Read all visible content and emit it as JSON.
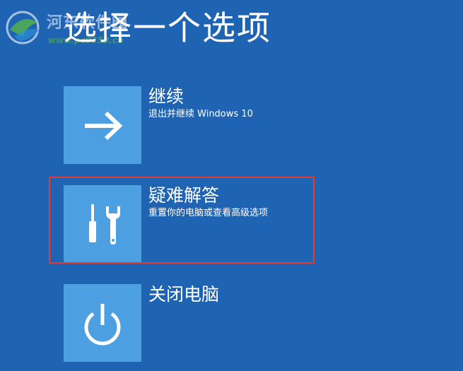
{
  "colors": {
    "background": "#1f63b3",
    "tile": "#4c9fe0",
    "highlight": "#e53935",
    "watermark_green": "#5fbf3a"
  },
  "page": {
    "title": "选择一个选项"
  },
  "watermark": {
    "text": "河东软件园",
    "url": "www.pc0359.cn"
  },
  "options": [
    {
      "label": "继续",
      "description": "退出并继续 Windows 10",
      "icon": "arrow-right-icon"
    },
    {
      "label": "疑难解答",
      "description": "重置你的电脑或查看高级选项",
      "icon": "tools-icon"
    },
    {
      "label": "关闭电脑",
      "description": "",
      "icon": "power-icon"
    }
  ]
}
